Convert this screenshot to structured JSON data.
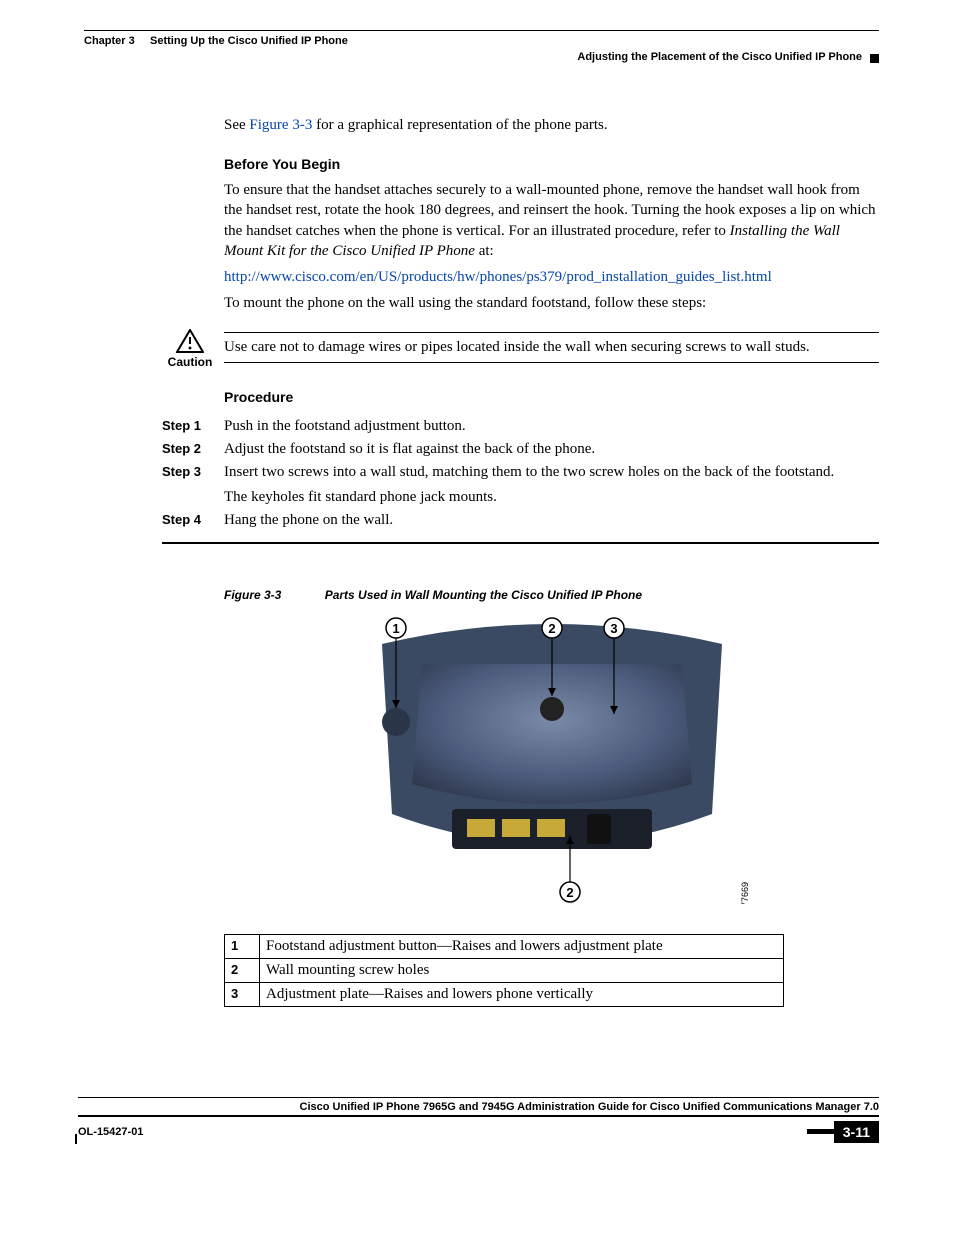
{
  "header": {
    "chapter_label": "Chapter 3",
    "chapter_title": "Setting Up the Cisco Unified IP Phone",
    "section_title": "Adjusting the Placement of the Cisco Unified IP Phone"
  },
  "intro": {
    "see_prefix": "See ",
    "fig_ref": "Figure 3-3",
    "see_suffix": " for a graphical representation of the phone parts."
  },
  "before": {
    "heading": "Before You Begin",
    "p1_a": "To ensure that the handset attaches securely to a wall-mounted phone, remove the handset wall hook from the handset rest, rotate the hook 180 degrees, and reinsert the hook. Turning the hook exposes a lip on which the handset catches when the phone is vertical. For an illustrated procedure, refer to ",
    "p1_ital": "Installing the Wall Mount Kit for the Cisco Unified IP Phone",
    "p1_b": " at:",
    "url": "http://www.cisco.com/en/US/products/hw/phones/ps379/prod_installation_guides_list.html",
    "p2": "To mount the phone on the wall using the standard footstand, follow these steps:"
  },
  "caution": {
    "label": "Caution",
    "text": "Use care not to damage wires or pipes located inside the wall when securing screws to wall studs."
  },
  "procedure": {
    "heading": "Procedure",
    "steps": [
      {
        "label": "Step 1",
        "text": "Push in the footstand adjustment button."
      },
      {
        "label": "Step 2",
        "text": "Adjust the footstand so it is flat against the back of the phone."
      },
      {
        "label": "Step 3",
        "text": "Insert two screws into a wall stud, matching them to the two screw holes on the back of the footstand.",
        "text2": "The keyholes fit standard phone jack mounts."
      },
      {
        "label": "Step 4",
        "text": "Hang the phone on the wall."
      }
    ]
  },
  "figure": {
    "number": "Figure 3-3",
    "title": "Parts Used in Wall Mounting the Cisco Unified IP Phone",
    "image_id_label": "77669",
    "callouts": [
      "1",
      "2",
      "3",
      "2"
    ]
  },
  "parts": [
    {
      "n": "1",
      "desc": "Footstand adjustment button—Raises and lowers adjustment plate"
    },
    {
      "n": "2",
      "desc": "Wall mounting screw holes"
    },
    {
      "n": "3",
      "desc": "Adjustment plate—Raises and lowers phone vertically"
    }
  ],
  "footer": {
    "book_title": "Cisco Unified IP Phone 7965G and 7945G Administration Guide for Cisco Unified Communications Manager 7.0",
    "doc_id": "OL-15427-01",
    "page": "3-11"
  }
}
